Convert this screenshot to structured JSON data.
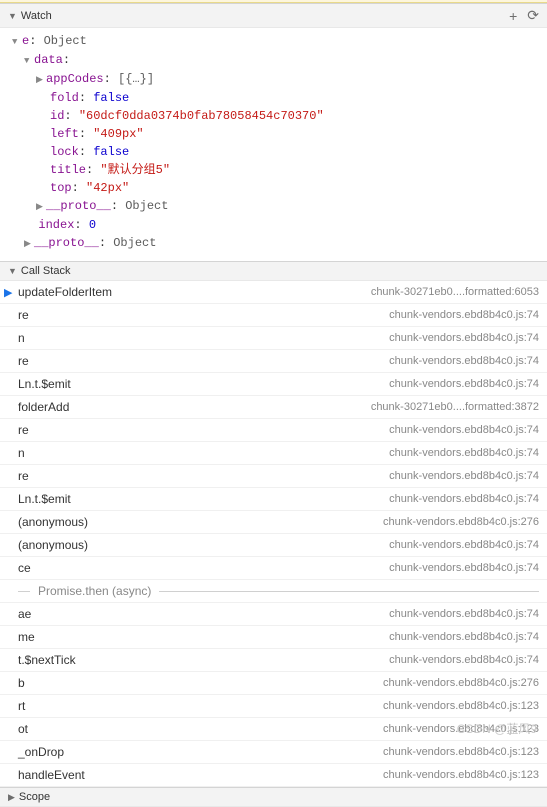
{
  "panels": {
    "watch": {
      "title": "Watch"
    },
    "callstack": {
      "title": "Call Stack"
    },
    "scope": {
      "title": "Scope"
    }
  },
  "watch": {
    "root": {
      "key": "e",
      "type": "Object"
    },
    "data_label": "data",
    "props": {
      "appCodes": {
        "key": "appCodes",
        "val": "[{…}]"
      },
      "fold": {
        "key": "fold",
        "val": "false"
      },
      "id": {
        "key": "id",
        "val": "\"60dcf0dda0374b0fab78058454c70370\""
      },
      "left": {
        "key": "left",
        "val": "\"409px\""
      },
      "lock": {
        "key": "lock",
        "val": "false"
      },
      "title": {
        "key": "title",
        "val": "\"默认分组5\""
      },
      "top": {
        "key": "top",
        "val": "\"42px\""
      },
      "proto1": {
        "key": "__proto__",
        "val": "Object"
      }
    },
    "index": {
      "key": "index",
      "val": "0"
    },
    "proto2": {
      "key": "__proto__",
      "val": "Object"
    }
  },
  "callstack": {
    "async_label": "Promise.then (async)",
    "frames": [
      {
        "fn": "updateFolderItem",
        "loc": "chunk-30271eb0....formatted:6053",
        "current": true
      },
      {
        "fn": "re",
        "loc": "chunk-vendors.ebd8b4c0.js:74"
      },
      {
        "fn": "n",
        "loc": "chunk-vendors.ebd8b4c0.js:74"
      },
      {
        "fn": "re",
        "loc": "chunk-vendors.ebd8b4c0.js:74"
      },
      {
        "fn": "Ln.t.$emit",
        "loc": "chunk-vendors.ebd8b4c0.js:74"
      },
      {
        "fn": "folderAdd",
        "loc": "chunk-30271eb0....formatted:3872"
      },
      {
        "fn": "re",
        "loc": "chunk-vendors.ebd8b4c0.js:74"
      },
      {
        "fn": "n",
        "loc": "chunk-vendors.ebd8b4c0.js:74"
      },
      {
        "fn": "re",
        "loc": "chunk-vendors.ebd8b4c0.js:74"
      },
      {
        "fn": "Ln.t.$emit",
        "loc": "chunk-vendors.ebd8b4c0.js:74"
      },
      {
        "fn": "(anonymous)",
        "loc": "chunk-vendors.ebd8b4c0.js:276"
      },
      {
        "fn": "(anonymous)",
        "loc": "chunk-vendors.ebd8b4c0.js:74"
      },
      {
        "fn": "ce",
        "loc": "chunk-vendors.ebd8b4c0.js:74"
      }
    ],
    "frames_after": [
      {
        "fn": "ae",
        "loc": "chunk-vendors.ebd8b4c0.js:74"
      },
      {
        "fn": "me",
        "loc": "chunk-vendors.ebd8b4c0.js:74"
      },
      {
        "fn": "t.$nextTick",
        "loc": "chunk-vendors.ebd8b4c0.js:74"
      },
      {
        "fn": "b",
        "loc": "chunk-vendors.ebd8b4c0.js:276"
      },
      {
        "fn": "rt",
        "loc": "chunk-vendors.ebd8b4c0.js:123"
      },
      {
        "fn": "ot",
        "loc": "chunk-vendors.ebd8b4c0.js:123"
      },
      {
        "fn": "_onDrop",
        "loc": "chunk-vendors.ebd8b4c0.js:123"
      },
      {
        "fn": "handleEvent",
        "loc": "chunk-vendors.ebd8b4c0.js:123"
      }
    ]
  },
  "watermark": "CSDN @蓝风9"
}
